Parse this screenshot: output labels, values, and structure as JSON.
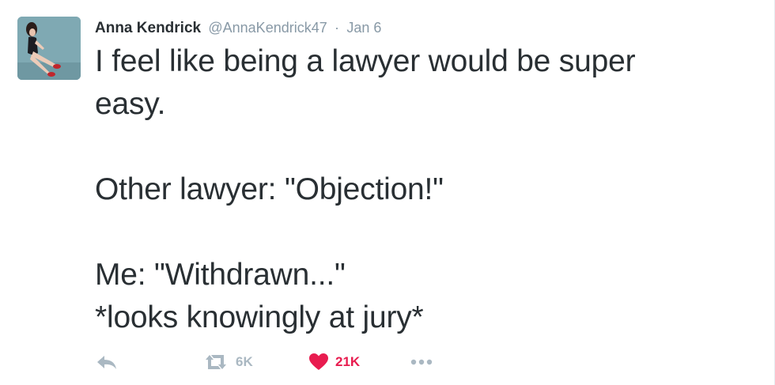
{
  "tweet": {
    "fullname": "Anna Kendrick",
    "username": "@AnnaKendrick47",
    "separator": "·",
    "timestamp": "Jan 6",
    "lines": [
      "I feel like being a lawyer would be super",
      "easy.",
      "",
      "Other lawyer: \"Objection!\"",
      "",
      "Me: \"Withdrawn...\"",
      "*looks knowingly at jury*"
    ]
  },
  "actions": {
    "reply_icon": "reply-icon",
    "retweet_icon": "retweet-icon",
    "retweet_count": "6K",
    "like_icon": "heart-icon",
    "like_count": "21K",
    "more_icon": "more-dots-icon"
  },
  "colors": {
    "muted": "#8899a6",
    "icon": "#aab8c2",
    "like": "#e81c4f",
    "text": "#292f33"
  }
}
